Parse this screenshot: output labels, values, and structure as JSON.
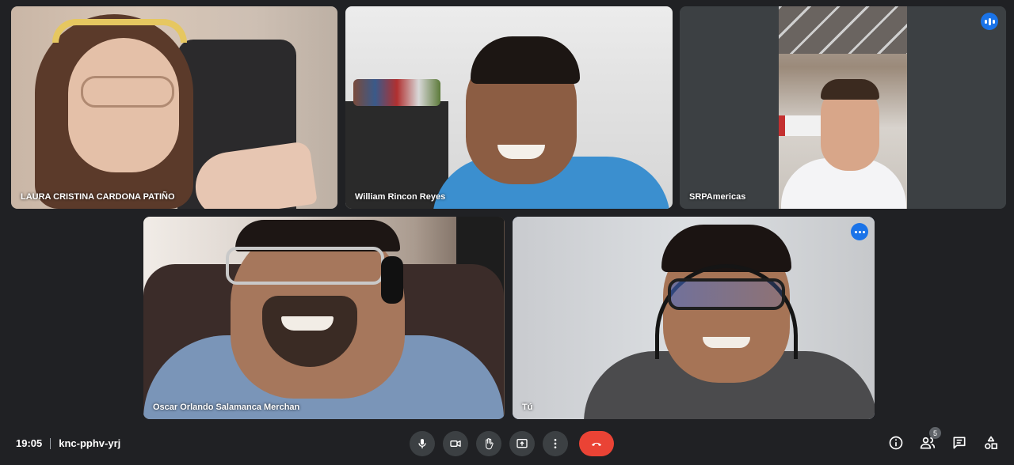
{
  "participants": [
    {
      "name": "LAURA CRISTINA CARDONA PATIÑO"
    },
    {
      "name": "William Rincon Reyes"
    },
    {
      "name": "SRPAmericas",
      "speaking_icon": "speaking-indicator-icon"
    },
    {
      "name": "Oscar Orlando Salamanca Merchan"
    },
    {
      "name": "Tú",
      "menu_icon": "more-options-icon"
    }
  ],
  "meeting": {
    "time": "19:05",
    "code": "knc-pphv-yrj"
  },
  "controls": {
    "icons": [
      "microphone-icon",
      "camera-icon",
      "raise-hand-icon",
      "present-screen-icon",
      "more-vert-icon",
      "end-call-icon"
    ]
  },
  "side_panel": {
    "participant_count": "5",
    "icons": [
      "info-icon",
      "people-icon",
      "chat-icon",
      "activities-icon"
    ]
  },
  "colors": {
    "background": "#202124",
    "tile": "#3c4043",
    "accent": "#1a73e8",
    "active_outline": "#8ab4f8",
    "end_call": "#ea4335"
  }
}
